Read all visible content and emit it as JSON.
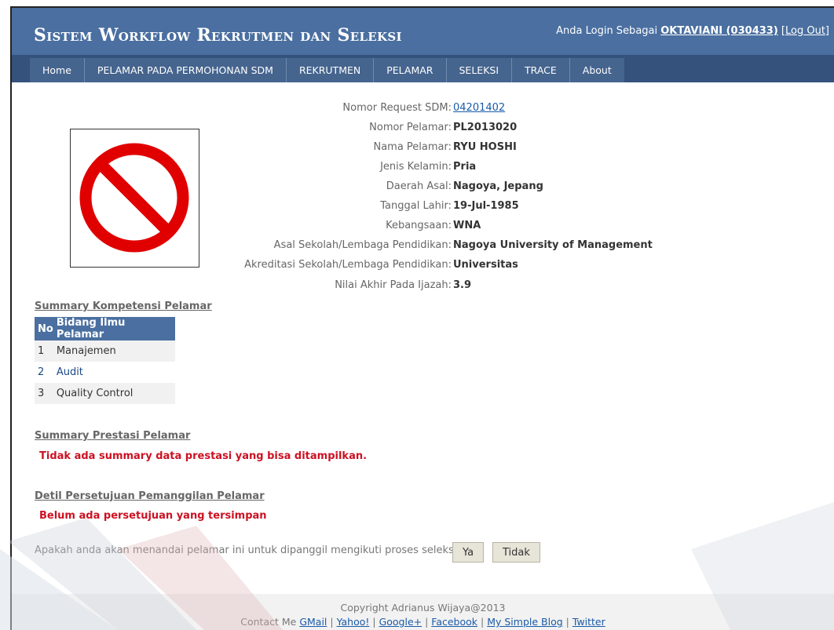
{
  "header": {
    "title": "Sistem Workflow Rekrutmen dan Seleksi",
    "login_prefix": "Anda Login Sebagai",
    "user": "OKTAVIANI (030433)",
    "logout_open": "[",
    "logout": "Log Out",
    "logout_close": "]"
  },
  "nav": [
    "Home",
    "PELAMAR PADA PERMOHONAN SDM",
    "REKRUTMEN",
    "PELAMAR",
    "SELEKSI",
    "TRACE",
    "About"
  ],
  "applicant": {
    "fields": [
      {
        "label": "Nomor Request SDM:",
        "value": "04201402",
        "link": true
      },
      {
        "label": "Nomor Pelamar:",
        "value": "PL2013020"
      },
      {
        "label": "Nama Pelamar:",
        "value": "RYU HOSHI"
      },
      {
        "label": "Jenis Kelamin:",
        "value": "Pria"
      },
      {
        "label": "Daerah Asal:",
        "value": "Nagoya, Jepang"
      },
      {
        "label": "Tanggal Lahir:",
        "value": "19-Jul-1985"
      },
      {
        "label": "Kebangsaan:",
        "value": "WNA"
      },
      {
        "label": "Asal Sekolah/Lembaga Pendidikan:",
        "value": "Nagoya University of Management"
      },
      {
        "label": "Akreditasi Sekolah/Lembaga Pendidikan:",
        "value": "Universitas"
      },
      {
        "label": "Nilai Akhir Pada Ijazah:",
        "value": "3.9"
      }
    ],
    "photo_icon": "prohibited-icon"
  },
  "competency": {
    "heading": "Summary Kompetensi Pelamar",
    "columns": [
      "No",
      "Bidang Ilmu Pelamar"
    ],
    "rows": [
      [
        "1",
        "Manajemen"
      ],
      [
        "2",
        "Audit"
      ],
      [
        "3",
        "Quality Control"
      ]
    ]
  },
  "achievement": {
    "heading": "Summary Prestasi Pelamar",
    "message": "Tidak ada summary data prestasi yang bisa ditampilkan."
  },
  "approval": {
    "heading": "Detil Persetujuan Pemanggilan Pelamar",
    "message": "Belum ada persetujuan yang tersimpan"
  },
  "action": {
    "question": "Apakah anda akan menandai pelamar ini untuk dipanggil mengikuti proses seleksi?",
    "yes": "Ya",
    "no": "Tidak"
  },
  "footer": {
    "copyright": "Copyright Adrianus Wijaya@2013",
    "contact": "Contact Me",
    "links": [
      "GMail",
      "Yahoo!",
      "Google+",
      "Facebook",
      "My Simple Blog",
      "Twitter"
    ]
  },
  "colors": {
    "header": "#4a6fa0",
    "nav": "#34527b",
    "alert": "#cc1122"
  }
}
